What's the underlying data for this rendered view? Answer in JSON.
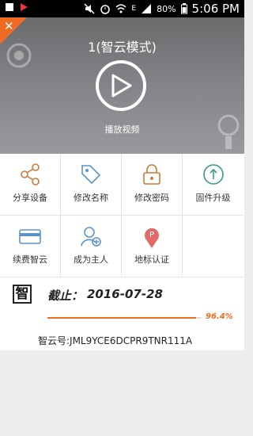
{
  "status_bar": {
    "battery": "80%",
    "time": "5:06 PM",
    "network": "E"
  },
  "hero": {
    "device_title": "1(智云模式)",
    "play_label": "播放视频"
  },
  "actions": [
    {
      "label": "分享设备",
      "icon": "share-icon"
    },
    {
      "label": "修改名称",
      "icon": "tag-icon"
    },
    {
      "label": "修改密码",
      "icon": "lock-icon"
    },
    {
      "label": "固件升级",
      "icon": "upgrade-icon"
    },
    {
      "label": "续费智云",
      "icon": "card-icon"
    },
    {
      "label": "成为主人",
      "icon": "user-add-icon"
    },
    {
      "label": "地标认证",
      "icon": "location-pin-icon"
    }
  ],
  "subscription": {
    "logo_char": "智",
    "expire_prefix": "截止：",
    "expire_date": "2016-07-28",
    "progress_percent": 96.4,
    "progress_label": "96.4%",
    "cloud_id": "智云号:JML9YCE6DCPR9TNR111A"
  },
  "colors": {
    "accent": "#ef6b22",
    "hero_bg": "#828286"
  }
}
